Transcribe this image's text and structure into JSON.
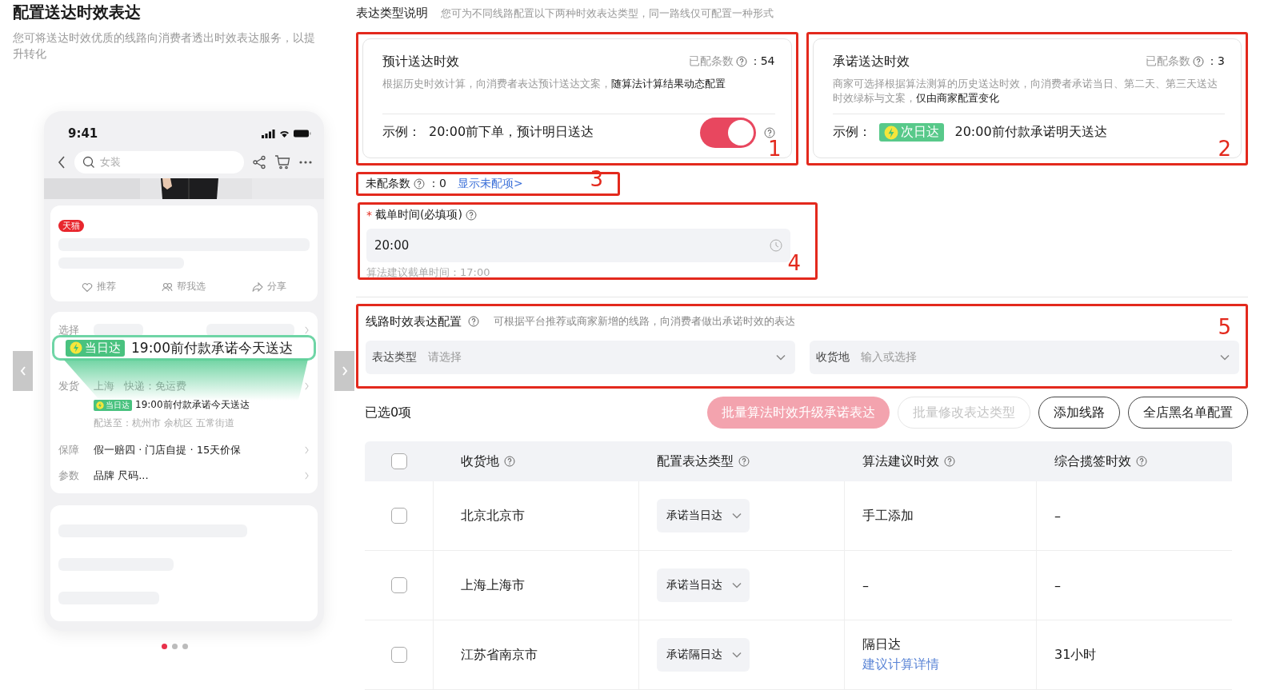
{
  "page": {
    "title": "配置送达时效表达",
    "subtitle": "您可将送达时效优质的线路向消费者透出时效表达服务，以提升转化"
  },
  "preview": {
    "time": "9:41",
    "search_placeholder": "女装",
    "tag": "天猫",
    "actions": [
      "推荐",
      "帮我选",
      "分享"
    ],
    "select_label": "选择",
    "callout": {
      "badge": "当日达",
      "text": "19:00前付款承诺今天送达"
    },
    "ship": {
      "label": "发货",
      "origin": "上海",
      "express": "快递：免运费",
      "badge": "当日达",
      "promise": "19:00前付款承诺今天送达",
      "address": "配送至：杭州市 余杭区 五常街道"
    },
    "rows": [
      {
        "label": "保障",
        "value": "假一赔四 · 门店自提 · 15天价保"
      },
      {
        "label": "参数",
        "value": "品牌 尺码..."
      }
    ],
    "pager": [
      {
        "selected": true
      },
      {
        "selected": false
      },
      {
        "selected": false
      }
    ]
  },
  "types": {
    "title": "表达类型说明",
    "hint": "您可为不同线路配置以下两种时效表达类型，同一路线仅可配置一种形式"
  },
  "cards": [
    {
      "kind": "toggle",
      "title": "预计送达时效",
      "count_label": "已配条数",
      "count": "：54",
      "desc": "根据历史时效计算，向消费者表达预计送达文案，**随算法计算结果动态配置**",
      "example_label": "示例：",
      "example": "20:00前下单，预计明日送达",
      "on": true,
      "annotation": "1"
    },
    {
      "kind": "badge",
      "title": "承诺送达时效",
      "count_label": "已配条数",
      "count": "：3",
      "desc": "商家可选择根据算法测算的历史送达时效，向消费者承诺当日、第二天、第三天送达时效绿标与文案，**仅由商家配置变化**",
      "example_label": "示例：",
      "badge": "次日达",
      "example": "20:00前付款承诺明天送达",
      "annotation": "2"
    }
  ],
  "unconfigured": {
    "label": "未配条数",
    "value": "：0",
    "link": "显示未配项>",
    "annotation": "3"
  },
  "cutoff": {
    "label": "截单时间(必填项)",
    "required_mark": "*",
    "value": "20:00",
    "hint": "算法建议截单时间：17:00",
    "annotation": "4"
  },
  "route_config": {
    "title": "线路时效表达配置",
    "hint": "可根据平台推荐或商家新增的线路，向消费者做出承诺时效的表达",
    "annotation": "5",
    "filters": [
      {
        "label": "表达类型",
        "placeholder": "请选择"
      },
      {
        "label": "收货地",
        "placeholder": "输入或选择"
      }
    ]
  },
  "selection": "已选0项",
  "buttons": [
    {
      "label": "批量算法时效升级承诺表达",
      "kind": "primary",
      "disabled": true
    },
    {
      "label": "批量修改表达类型",
      "kind": "outline",
      "disabled": true
    },
    {
      "label": "添加线路",
      "kind": "outline",
      "disabled": false
    },
    {
      "label": "全店黑名单配置",
      "kind": "outline",
      "disabled": false
    }
  ],
  "table": {
    "select_all_checked": false,
    "columns": [
      "收货地",
      "配置表达类型",
      "算法建议时效",
      "综合揽签时效"
    ],
    "rows": [
      {
        "checked": false,
        "destination": "北京北京市",
        "type": "承诺当日达",
        "suggestion": "手工添加",
        "pickup": "–"
      },
      {
        "checked": false,
        "destination": "上海上海市",
        "type": "承诺当日达",
        "suggestion": "–",
        "pickup": "–"
      },
      {
        "checked": false,
        "destination": "江苏省南京市",
        "type": "承诺隔日达",
        "suggestion": "隔日达",
        "suggestion_link": "建议计算详情",
        "pickup": "31小时"
      }
    ]
  }
}
